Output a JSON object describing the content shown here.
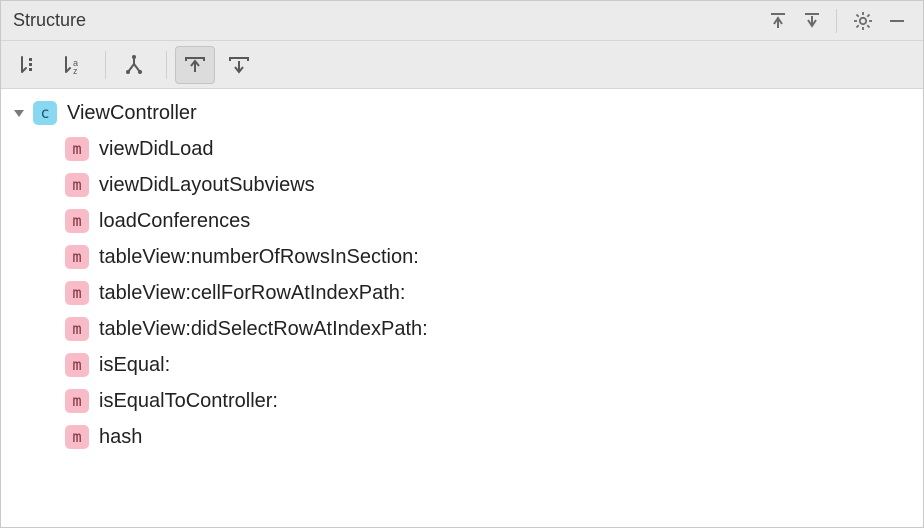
{
  "header": {
    "title": "Structure"
  },
  "toolbar": {
    "sortDefinition": "Sort by Definition Order",
    "sortAlpha": "Sort Alphabetically",
    "showInherited": "Show Inherited",
    "collapseToDef": "Scroll From Source",
    "expandFromDef": "Scroll To Source"
  },
  "tree": {
    "root": {
      "kind": "class",
      "badge": "c",
      "label": "ViewController",
      "expanded": true,
      "children": [
        {
          "kind": "method",
          "badge": "m",
          "label": "viewDidLoad"
        },
        {
          "kind": "method",
          "badge": "m",
          "label": "viewDidLayoutSubviews"
        },
        {
          "kind": "method",
          "badge": "m",
          "label": "loadConferences"
        },
        {
          "kind": "method",
          "badge": "m",
          "label": "tableView:numberOfRowsInSection:"
        },
        {
          "kind": "method",
          "badge": "m",
          "label": "tableView:cellForRowAtIndexPath:"
        },
        {
          "kind": "method",
          "badge": "m",
          "label": "tableView:didSelectRowAtIndexPath:"
        },
        {
          "kind": "method",
          "badge": "m",
          "label": "isEqual:"
        },
        {
          "kind": "method",
          "badge": "m",
          "label": "isEqualToController:"
        },
        {
          "kind": "method",
          "badge": "m",
          "label": "hash"
        }
      ]
    }
  }
}
